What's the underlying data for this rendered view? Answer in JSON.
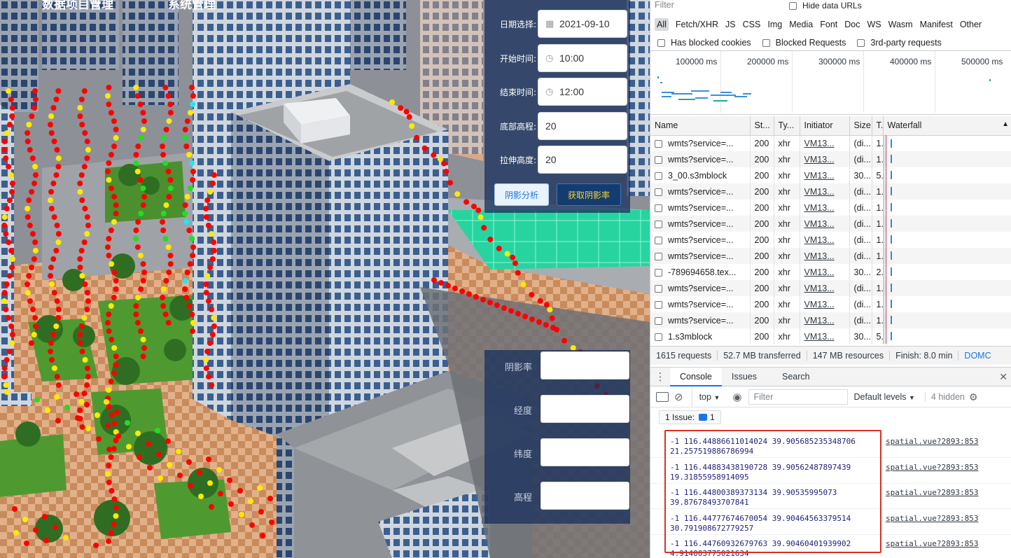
{
  "scene": {
    "top_nav": [
      "数据项目管理",
      "系统管理"
    ],
    "form": {
      "date_label": "日期选择:",
      "date_value": "2021-09-10",
      "start_label": "开始时间:",
      "start_value": "10:00",
      "end_label": "结束时间:",
      "end_value": "12:00",
      "base_label": "底部高程:",
      "base_value": "20",
      "extrude_label": "拉伸高度:",
      "extrude_value": "20",
      "analyze_button": "阴影分析",
      "get_rate_button": "获取阴影率"
    },
    "result": {
      "rate_label": "阴影率",
      "lon_label": "经度",
      "lat_label": "纬度",
      "elev_label": "高程"
    },
    "colors": {
      "shadow": "#ff0000",
      "partial": "#ffea00",
      "lit": "#22dd22",
      "cyan": "#22e6f0"
    }
  },
  "devtools": {
    "filter_placeholder": "Filter",
    "hide_data_urls": "Hide data URLs",
    "type_filters": [
      "All",
      "Fetch/XHR",
      "JS",
      "CSS",
      "Img",
      "Media",
      "Font",
      "Doc",
      "WS",
      "Wasm",
      "Manifest",
      "Other"
    ],
    "has_blocked_cookies": "Has blocked cookies",
    "blocked_requests": "Blocked Requests",
    "third_party": "3rd-party requests",
    "overview_ticks": [
      "100000 ms",
      "200000 ms",
      "300000 ms",
      "400000 ms",
      "500000 ms"
    ],
    "columns": [
      "Name",
      "St...",
      "Ty...",
      "Initiator",
      "Size",
      "T.",
      "Waterfall"
    ],
    "rows": [
      {
        "name": "wmts?service=...",
        "status": "200",
        "type": "xhr",
        "initiator": "VM13...",
        "size": "(di...",
        "time": "1..."
      },
      {
        "name": "wmts?service=...",
        "status": "200",
        "type": "xhr",
        "initiator": "VM13...",
        "size": "(di...",
        "time": "1..."
      },
      {
        "name": "3_00.s3mblock",
        "status": "200",
        "type": "xhr",
        "initiator": "VM13...",
        "size": "30...",
        "time": "5..."
      },
      {
        "name": "wmts?service=...",
        "status": "200",
        "type": "xhr",
        "initiator": "VM13...",
        "size": "(di...",
        "time": "1..."
      },
      {
        "name": "wmts?service=...",
        "status": "200",
        "type": "xhr",
        "initiator": "VM13...",
        "size": "(di...",
        "time": "1..."
      },
      {
        "name": "wmts?service=...",
        "status": "200",
        "type": "xhr",
        "initiator": "VM13...",
        "size": "(di...",
        "time": "1..."
      },
      {
        "name": "wmts?service=...",
        "status": "200",
        "type": "xhr",
        "initiator": "VM13...",
        "size": "(di...",
        "time": "1..."
      },
      {
        "name": "wmts?service=...",
        "status": "200",
        "type": "xhr",
        "initiator": "VM13...",
        "size": "(di...",
        "time": "1..."
      },
      {
        "name": "-789694658.tex...",
        "status": "200",
        "type": "xhr",
        "initiator": "VM13...",
        "size": "30...",
        "time": "2..."
      },
      {
        "name": "wmts?service=...",
        "status": "200",
        "type": "xhr",
        "initiator": "VM13...",
        "size": "(di...",
        "time": "1..."
      },
      {
        "name": "wmts?service=...",
        "status": "200",
        "type": "xhr",
        "initiator": "VM13...",
        "size": "(di...",
        "time": "1..."
      },
      {
        "name": "wmts?service=...",
        "status": "200",
        "type": "xhr",
        "initiator": "VM13...",
        "size": "(di...",
        "time": "1..."
      },
      {
        "name": "1.s3mblock",
        "status": "200",
        "type": "xhr",
        "initiator": "VM13...",
        "size": "30...",
        "time": "5..."
      }
    ],
    "summary": [
      "1615 requests",
      "52.7 MB transferred",
      "147 MB resources",
      "Finish: 8.0 min",
      "DOMC"
    ],
    "drawer_tabs": [
      "Console",
      "Issues",
      "Search"
    ],
    "context": "top",
    "console_filter_placeholder": "Filter",
    "default_levels": "Default levels",
    "hidden_count": "4 hidden",
    "issues_badge": "1 Issue:",
    "issues_count": "1",
    "logs": [
      {
        "line1": "-1 116.44886611014024 39.905685235348706",
        "line2": "21.257519886786994",
        "source": "spatial.vue?2893:853"
      },
      {
        "line1": "-1 116.44883438190728 39.90562487897439",
        "line2": "19.31855958914095",
        "source": "spatial.vue?2893:853"
      },
      {
        "line1": "-1 116.44800389373134 39.90535995073",
        "line2": "39.87678493707841",
        "source": "spatial.vue?2893:853"
      },
      {
        "line1": "-1 116.44777674670054 39.90464563379514",
        "line2": "30.791908672779257",
        "source": "spatial.vue?2893:853"
      },
      {
        "line1": "-1 116.44760932679763 39.90460401939902",
        "line2": "4.914003775021634",
        "source": "spatial.vue?2893:853"
      }
    ],
    "highlight_color": "#d93025"
  }
}
